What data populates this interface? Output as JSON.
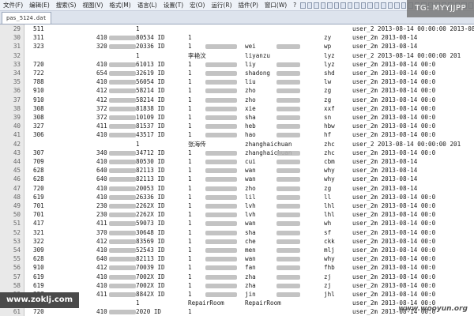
{
  "menu": [
    "文件(F)",
    "编辑(E)",
    "搜索(S)",
    "视图(V)",
    "格式(M)",
    "语言(L)",
    "设置(T)",
    "宏(O)",
    "运行(R)",
    "插件(P)",
    "窗口(W)",
    "?"
  ],
  "tabs": [
    {
      "label": "pas_5124.dat",
      "active": true
    }
  ],
  "rows": [
    {
      "ln": "29",
      "c1": "511",
      "c2": "",
      "c3": "1",
      "c4": "",
      "c5": "",
      "c6": "",
      "c7": "user_2 2013-08-14 00:00:00 2013-08-15 08:56:44"
    },
    {
      "ln": "30",
      "c1": "311",
      "c2": "410",
      "c3": "80534 ID",
      "c4": "1",
      "c5": "",
      "c6": "zy",
      "c7": "user_2m 2013-08-14"
    },
    {
      "ln": "31",
      "c1": "323",
      "c2": "320",
      "c3": "20336 ID",
      "c4": "1",
      "c5": "wei",
      "c6": "wp",
      "c7": "user_2m 2013-08-14"
    },
    {
      "ln": "32",
      "c1": "",
      "c2": "",
      "c3": "1",
      "c4": "李艳汶",
      "c5": "liyanzu",
      "c6": "lyz",
      "c7": "user_2 2013-08-14 00:00:00 201"
    },
    {
      "ln": "33",
      "c1": "720",
      "c2": "410",
      "c3": "61013 ID",
      "c4": "1",
      "c5": "liy",
      "c6": "lyz",
      "c7": "user_2m 2013-08-14 00:0"
    },
    {
      "ln": "34",
      "c1": "722",
      "c2": "654",
      "c3": "32619 ID",
      "c4": "1",
      "c5": "shadong",
      "c6": "shd",
      "c7": "user_2m 2013-08-14 00:0"
    },
    {
      "ln": "35",
      "c1": "788",
      "c2": "410",
      "c3": "56054 ID",
      "c4": "1",
      "c5": "liu",
      "c6": "lw",
      "c7": "user_2m 2013-08-14 00:0"
    },
    {
      "ln": "36",
      "c1": "910",
      "c2": "412",
      "c3": "58214 ID",
      "c4": "1",
      "c5": "zho",
      "c6": "zg",
      "c7": "user_2m 2013-08-14 00:0"
    },
    {
      "ln": "37",
      "c1": "910",
      "c2": "412",
      "c3": "58214 ID",
      "c4": "1",
      "c5": "zho",
      "c6": "zg",
      "c7": "user_2m 2013-08-14 00:0"
    },
    {
      "ln": "38",
      "c1": "308",
      "c2": "372",
      "c3": "81838 ID",
      "c4": "1",
      "c5": "xie",
      "c6": "xxf",
      "c7": "user_2m 2013-08-14 00:0"
    },
    {
      "ln": "39",
      "c1": "308",
      "c2": "372",
      "c3": "10109 ID",
      "c4": "1",
      "c5": "sha",
      "c6": "sn",
      "c7": "user_2m 2013-08-14 00:0"
    },
    {
      "ln": "40",
      "c1": "327",
      "c2": "411",
      "c3": "81537 ID",
      "c4": "1",
      "c5": "heb",
      "c6": "hbw",
      "c7": "user_2m 2013-08-14 00:0"
    },
    {
      "ln": "41",
      "c1": "306",
      "c2": "410",
      "c3": "43517 ID",
      "c4": "1",
      "c5": "hao",
      "c6": "hf",
      "c7": "user_2m 2013-08-14 00:0"
    },
    {
      "ln": "42",
      "c1": "",
      "c2": "",
      "c3": "1",
      "c4": "张海传",
      "c5": "zhanghaichuan",
      "c6": "zhc",
      "c7": "user_2 2013-08-14 00:00:00 201"
    },
    {
      "ln": "43",
      "c1": "307",
      "c2": "340",
      "c3": "34712 ID",
      "c4": "1",
      "c5": "zhanghaichuan",
      "c6": "zhc",
      "c7": "user_2m 2013-08-14 00:0"
    },
    {
      "ln": "44",
      "c1": "709",
      "c2": "410",
      "c3": "80530 ID",
      "c4": "1",
      "c5": "cui",
      "c6": "cbm",
      "c7": "user_2m 2013-08-14"
    },
    {
      "ln": "45",
      "c1": "628",
      "c2": "640",
      "c3": "82113 ID",
      "c4": "1",
      "c5": "wan",
      "c6": "why",
      "c7": "user_2m 2013-08-14"
    },
    {
      "ln": "46",
      "c1": "628",
      "c2": "640",
      "c3": "82113 ID",
      "c4": "1",
      "c5": "wan",
      "c6": "why",
      "c7": "user_2m 2013-08-14"
    },
    {
      "ln": "47",
      "c1": "720",
      "c2": "410",
      "c3": "20053 ID",
      "c4": "1",
      "c5": "zho",
      "c6": "zg",
      "c7": "user_2m 2013-08-14"
    },
    {
      "ln": "48",
      "c1": "619",
      "c2": "410",
      "c3": "26336 ID",
      "c4": "1",
      "c5": "lil",
      "c6": "ll",
      "c7": "user_2m 2013-08-14 00:0"
    },
    {
      "ln": "49",
      "c1": "701",
      "c2": "230",
      "c3": "2262X ID",
      "c4": "1",
      "c5": "lvh",
      "c6": "lhl",
      "c7": "user_2m 2013-08-14 00:0"
    },
    {
      "ln": "50",
      "c1": "701",
      "c2": "230",
      "c3": "2262X ID",
      "c4": "1",
      "c5": "lvh",
      "c6": "lhl",
      "c7": "user_2m 2013-08-14 00:0"
    },
    {
      "ln": "51",
      "c1": "417",
      "c2": "411",
      "c3": "59073 ID",
      "c4": "1",
      "c5": "wan",
      "c6": "wh",
      "c7": "user_2m 2013-08-14 00:0"
    },
    {
      "ln": "52",
      "c1": "321",
      "c2": "370",
      "c3": "30648 ID",
      "c4": "1",
      "c5": "sha",
      "c6": "sf",
      "c7": "user_2m 2013-08-14 00:0"
    },
    {
      "ln": "53",
      "c1": "322",
      "c2": "412",
      "c3": "83569 ID",
      "c4": "1",
      "c5": "che",
      "c6": "ckk",
      "c7": "user_2m 2013-08-14 00:0"
    },
    {
      "ln": "54",
      "c1": "309",
      "c2": "410",
      "c3": "52543 ID",
      "c4": "1",
      "c5": "men",
      "c6": "mlj",
      "c7": "user_2m 2013-08-14 00:0"
    },
    {
      "ln": "55",
      "c1": "628",
      "c2": "640",
      "c3": "82113 ID",
      "c4": "1",
      "c5": "wan",
      "c6": "why",
      "c7": "user_2m 2013-08-14 00:0"
    },
    {
      "ln": "56",
      "c1": "910",
      "c2": "412",
      "c3": "70039 ID",
      "c4": "1",
      "c5": "fan",
      "c6": "fhb",
      "c7": "user_2m 2013-08-14 00:0"
    },
    {
      "ln": "57",
      "c1": "619",
      "c2": "410",
      "c3": "7002X ID",
      "c4": "1",
      "c5": "zha",
      "c6": "zj",
      "c7": "user_2m 2013-08-14 00:0"
    },
    {
      "ln": "58",
      "c1": "619",
      "c2": "410",
      "c3": "7002X ID",
      "c4": "1",
      "c5": "zha",
      "c6": "zj",
      "c7": "user_2m 2013-08-14 00:0"
    },
    {
      "ln": "59",
      "c1": "327",
      "c2": "411",
      "c3": "8842X ID",
      "c4": "1",
      "c5": "jin",
      "c6": "jhl",
      "c7": "user_2m 2013-08-14 00:0"
    },
    {
      "ln": "60",
      "c1": "",
      "c2": "",
      "c3": "1",
      "c4": "RepairRoom",
      "c5": "RepairRoom",
      "c6": "",
      "c7": "user_2m 2013-08-14 00:0"
    },
    {
      "ln": "61",
      "c1": "720",
      "c2": "410",
      "c3": "2020 ID",
      "c4": "1",
      "c5": "",
      "c6": "",
      "c7": "user_2m 2013-08-14 00:0"
    }
  ],
  "watermarks": {
    "top_right": "TG: MYYJJPP",
    "bottom_left": "www.zoklj.com",
    "bottom_right": "www.wooyun.org"
  }
}
